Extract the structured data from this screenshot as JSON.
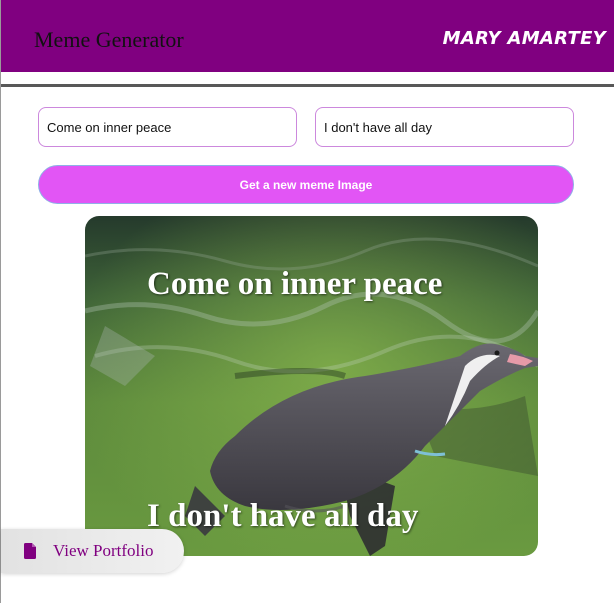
{
  "header": {
    "title": "Meme Generator",
    "author": "MARY AMARTEY"
  },
  "form": {
    "top_text_value": "Come on inner peace",
    "bottom_text_value": "I don't have all day",
    "submit_label": "Get a new meme Image"
  },
  "meme": {
    "top_text": "Come on inner peace",
    "bottom_text": "I don't have all day",
    "image_icon": "penguin-photo"
  },
  "portfolio_link": {
    "label": "View Portfolio",
    "icon": "file-icon"
  },
  "colors": {
    "header_bg": "#800080",
    "button_bg": "#e255f5",
    "input_border": "#cc88dd",
    "link_text": "#800080"
  }
}
